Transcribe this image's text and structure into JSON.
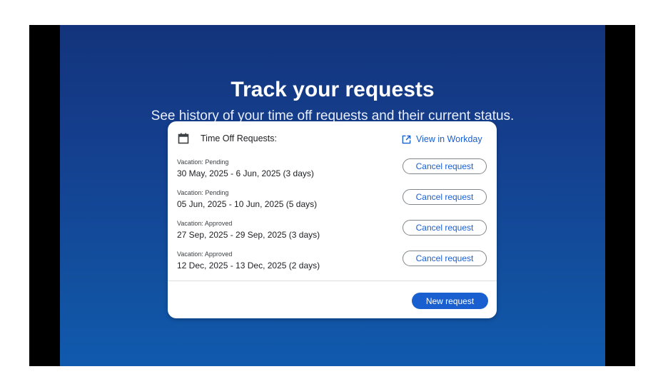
{
  "hero": {
    "title": "Track your requests",
    "subtitle": "See history of your time off requests and their current status."
  },
  "card": {
    "header": {
      "icon": "calendar-icon",
      "title": "Time Off Requests:",
      "link_icon": "open-in-new-icon",
      "link_label": "View in Workday"
    },
    "requests": [
      {
        "status": "Vacation: Pending",
        "dates": "30 May, 2025 - 6 Jun, 2025 (3 days)",
        "action": "Cancel request"
      },
      {
        "status": "Vacation: Pending",
        "dates": "05 Jun, 2025 - 10 Jun, 2025 (5 days)",
        "action": "Cancel request"
      },
      {
        "status": "Vacation: Approved",
        "dates": "27 Sep, 2025 - 29 Sep, 2025 (3 days)",
        "action": "Cancel request"
      },
      {
        "status": "Vacation: Approved",
        "dates": "12 Dec, 2025 - 13 Dec, 2025 (2 days)",
        "action": "Cancel request"
      }
    ],
    "new_request_label": "New request"
  },
  "colors": {
    "accent": "#1a5fd0",
    "background_top": "#13347c",
    "background_bottom": "#105aae"
  }
}
